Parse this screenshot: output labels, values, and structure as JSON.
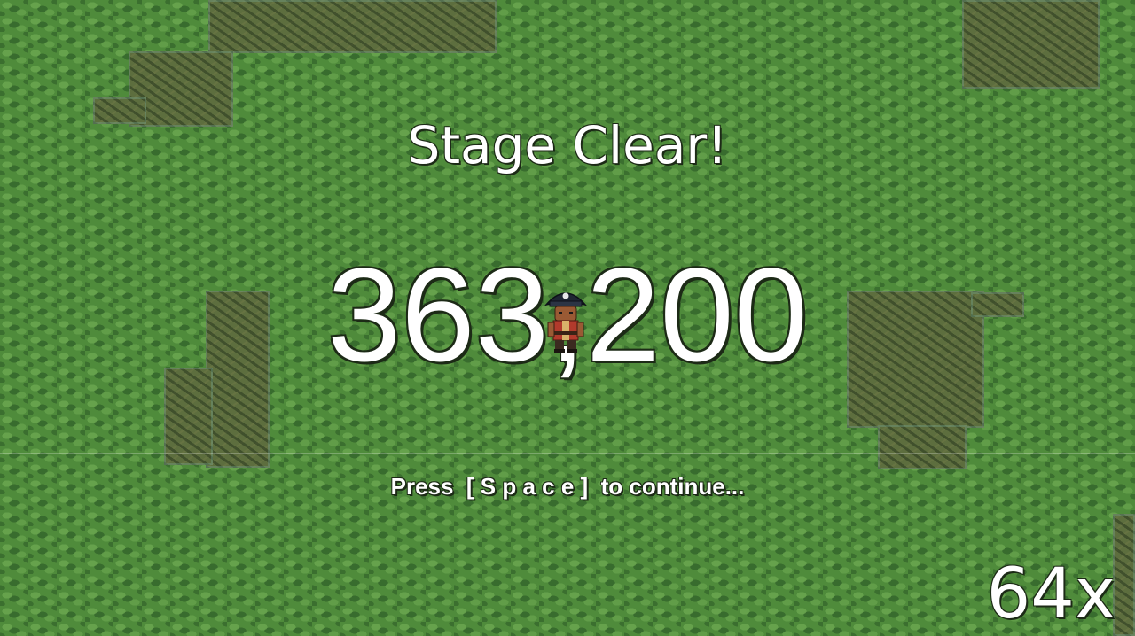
{
  "screen": {
    "title": "Stage Clear!",
    "score": "363,200",
    "prompt": "Press  [ S p a c e ]  to continue...",
    "multiplier": "64x"
  },
  "player": {
    "icon": "pirate-character-icon"
  },
  "colors": {
    "grass": "#4f8b3b",
    "dirt": "#5d6e3e",
    "text": "#ffffff"
  }
}
